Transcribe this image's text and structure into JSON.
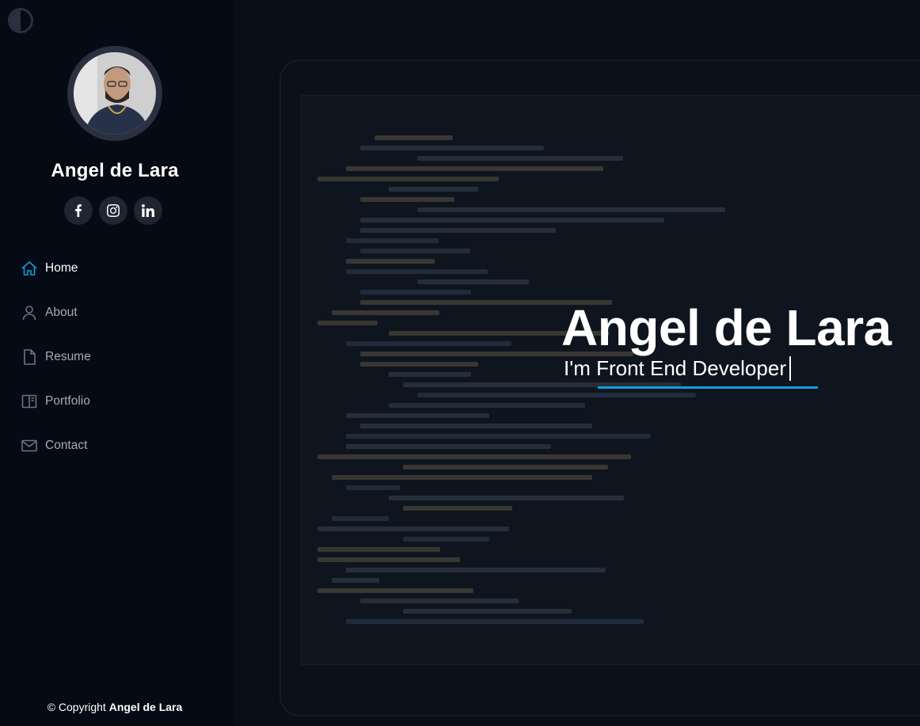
{
  "profile": {
    "name": "Angel de Lara"
  },
  "social": [
    {
      "icon": "facebook-icon"
    },
    {
      "icon": "instagram-icon"
    },
    {
      "icon": "linkedin-icon"
    }
  ],
  "nav": {
    "items": [
      {
        "label": "Home",
        "icon": "home-icon",
        "active": true
      },
      {
        "label": "About",
        "icon": "person-icon",
        "active": false
      },
      {
        "label": "Resume",
        "icon": "file-icon",
        "active": false
      },
      {
        "label": "Portfolio",
        "icon": "book-icon",
        "active": false
      },
      {
        "label": "Contact",
        "icon": "envelope-icon",
        "active": false
      }
    ]
  },
  "footer": {
    "copyright_prefix": "© Copyright",
    "copyright_name": "Angel de Lara"
  },
  "hero": {
    "title": "Angel de Lara",
    "subtitle": "I'm Front End Developer"
  },
  "colors": {
    "accent": "#149ddd",
    "sidebar_bg": "#040b14",
    "social_bg": "#212431"
  }
}
